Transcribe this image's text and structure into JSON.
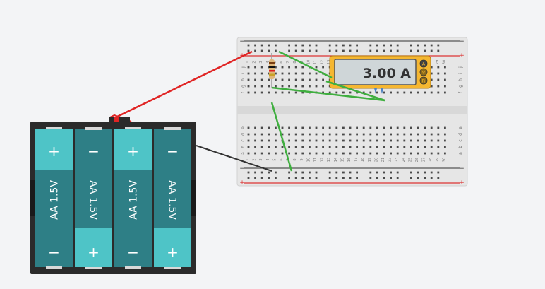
{
  "canvas": {
    "background": "#f3f4f6"
  },
  "breadboard": {
    "rail_plus": "+",
    "rail_minus": "−",
    "row_letters_top": [
      "j",
      "i",
      "h",
      "g",
      "f"
    ],
    "row_letters_bottom": [
      "e",
      "d",
      "c",
      "b",
      "a"
    ],
    "column_numbers": [
      "1",
      "2",
      "3",
      "4",
      "5",
      "6",
      "7",
      "8",
      "9",
      "10",
      "11",
      "12",
      "13",
      "14",
      "15",
      "16",
      "17",
      "18",
      "19",
      "20",
      "21",
      "22",
      "23",
      "24",
      "25",
      "26",
      "27",
      "28",
      "29",
      "30"
    ]
  },
  "multimeter": {
    "reading": "3.00 A",
    "mode_buttons": [
      "A",
      "V",
      "R"
    ],
    "selected_mode": "A",
    "body_color": "#f5b731"
  },
  "battery_pack": {
    "cells": [
      {
        "label": "AA 1.5V",
        "top_terminal": "+",
        "bottom_terminal": "−"
      },
      {
        "label": "AA 1.5V",
        "top_terminal": "−",
        "bottom_terminal": "+"
      },
      {
        "label": "AA 1.5V",
        "top_terminal": "+",
        "bottom_terminal": "−"
      },
      {
        "label": "AA 1.5V",
        "top_terminal": "−",
        "bottom_terminal": "+"
      }
    ],
    "cell_color": "#2e7f86",
    "cap_color": "#4ec4c7"
  },
  "wires": {
    "positive_color": "#e02424",
    "negative_color": "#333333",
    "jumper_color": "#3fae3f"
  },
  "resistor": {
    "bands": [
      "brown",
      "black",
      "red",
      "gold"
    ]
  }
}
